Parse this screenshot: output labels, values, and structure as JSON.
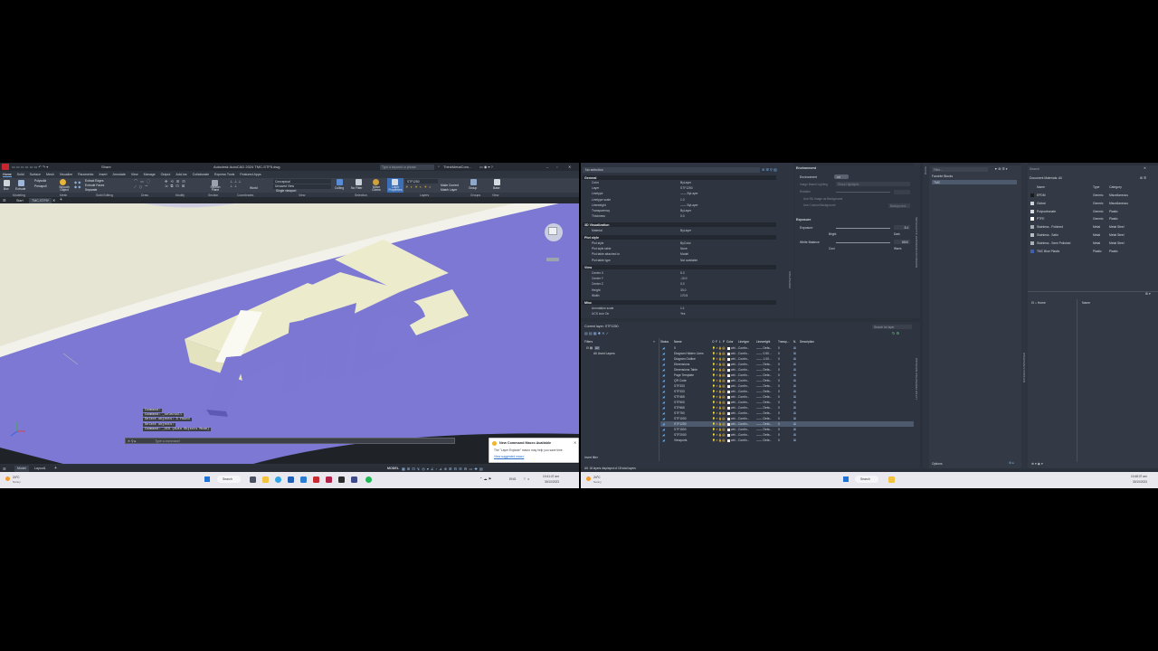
{
  "left": {
    "title": "Autodesk AutoCAD 2024    TMC-STF5.dwg",
    "share": "Share",
    "search_placeholder": "Type a keyword or phrase",
    "user": "ThinkMetalCom...",
    "tabs": [
      "Home",
      "Solid",
      "Surface",
      "Mesh",
      "Visualize",
      "Parametric",
      "Insert",
      "Annotate",
      "View",
      "Manage",
      "Output",
      "Add-ins",
      "Collaborate",
      "Express Tools",
      "Featured Apps"
    ],
    "ribbon": {
      "box": "Box",
      "extrude": "Extrude",
      "polysolid": "Polysolid",
      "presspull": "Presspull",
      "smooth_object": "Smooth Object",
      "extract_edges": "Extract Edges",
      "extrude_faces": "Extrude Faces",
      "separate": "Separate",
      "section_plane": "Section Plane",
      "visual_style": "Conceptual",
      "view": "Unsaved View",
      "world": "World",
      "single_viewport": "Single viewport",
      "culling": "Culling",
      "no_filter": "No Filter",
      "move_gizmo": "Move Gizmo",
      "layer_properties": "Layer Properties",
      "layer_current": "STF1250",
      "make_current": "Make Current",
      "match_layer": "Match Layer",
      "group": "Group",
      "base": "Base"
    },
    "ribbon_panels": [
      "Modeling",
      "Mesh",
      "Solid Editing",
      "Draw",
      "Modify",
      "Section",
      "Coordinates",
      "View",
      "Selection",
      "Layers",
      "Groups",
      "View"
    ],
    "doc_tabs": [
      "Start",
      "TMC-STF5*"
    ],
    "model_text": "TMC",
    "command_lines": [
      "Command:",
      "Command: _selectall",
      "Select objects: 3 found",
      "Select objects:",
      "Command: _UCS (Auto Objects Mode)"
    ],
    "command_placeholder": "Type a command",
    "layout_tabs": [
      "Model",
      "Layout1"
    ],
    "model_label": "MODEL",
    "notification": {
      "title": "New Command Macro Available",
      "body": "The \"Layer Explode\" macro may help you save time.",
      "link": "View suggested macro"
    },
    "taskbar": {
      "weather_temp": "24°C",
      "weather_desc": "Sunny",
      "search": "Search",
      "lang": "ENG",
      "time": "10:41:47 am",
      "date": "30/10/2023"
    }
  },
  "right": {
    "properties": {
      "selection": "No selection",
      "sections": {
        "general": "General",
        "visualization": "3D Visualization",
        "plot_style": "Plot style",
        "view": "View",
        "misc": "Misc"
      },
      "general_rows": [
        [
          "Color",
          "ByLayer"
        ],
        [
          "Layer",
          "STF1250"
        ],
        [
          "Linetype",
          "—— ByLayer"
        ],
        [
          "Linetype scale",
          "1.0"
        ],
        [
          "Lineweight",
          "—— ByLayer"
        ],
        [
          "Transparency",
          "ByLayer"
        ],
        [
          "Thickness",
          "0.0"
        ]
      ],
      "viz_rows": [
        [
          "Material",
          "ByLayer"
        ]
      ],
      "plot_rows": [
        [
          "Plot style",
          "ByColor"
        ],
        [
          "Plot style table",
          "None"
        ],
        [
          "Plot table attached to",
          "Model"
        ],
        [
          "Plot table type",
          "Not available"
        ]
      ],
      "view_rows": [
        [
          "Center X",
          "5.3"
        ],
        [
          "Center Y",
          "-10.0"
        ],
        [
          "Center Z",
          "0.0"
        ],
        [
          "Height",
          "33.0"
        ],
        [
          "Width",
          "170.5"
        ]
      ],
      "misc_rows": [
        [
          "Annotation scale",
          "1:1"
        ],
        [
          "UCS icon On",
          "Yes"
        ]
      ]
    },
    "render": {
      "environment_title": "Environment",
      "environment_label": "Environment",
      "environment_value": "Off",
      "image_lighting": "Image Based Lighting",
      "image_lighting_value": "Sharp Highlights",
      "rotation": "Rotation",
      "use_ibl": "Use IBL Image as Background",
      "use_custom": "Use Custom Background",
      "background_btn": "Background...",
      "exposure_title": "Exposure",
      "exposure_label": "Exposure",
      "exposure_value": "8.4",
      "bright": "Bright",
      "dark": "Dark",
      "white_balance": "White Balance",
      "white_balance_value": "6500",
      "cool": "Cool",
      "warm": "Warm"
    },
    "layers": {
      "current_layer": "Current layer: STF1250",
      "search": "Search for layer",
      "filters_label": "Filters",
      "filter_all": "All",
      "filter_used": "All Used Layers",
      "invert_filter": "Invert filter",
      "columns": [
        "Status",
        "Name",
        "O",
        "F",
        "L",
        "P",
        "Color",
        "Linetype",
        "Lineweight",
        "Transp...",
        "N.",
        "Description"
      ],
      "rows": [
        [
          "0",
          "whi...",
          "Contin...",
          "—— Defa...",
          "0"
        ],
        [
          "Diagram Hidden Lines",
          "whi...",
          "Contin...",
          "—— 0.50...",
          "0"
        ],
        [
          "Diagram Outline",
          "whi...",
          "Contin...",
          "—— 1.00...",
          "0"
        ],
        [
          "Dimensions",
          "whi...",
          "Contin...",
          "—— Defa...",
          "0"
        ],
        [
          "Dimensions Table",
          "whi...",
          "Contin...",
          "—— Defa...",
          "0"
        ],
        [
          "Page Template",
          "whi...",
          "Contin...",
          "—— Defa...",
          "0"
        ],
        [
          "QR Code",
          "whi...",
          "Contin...",
          "—— Defa...",
          "0"
        ],
        [
          "STF333",
          "whi...",
          "Contin...",
          "—— Defa...",
          "0"
        ],
        [
          "STF333",
          "whi...",
          "Contin...",
          "—— Defa...",
          "0"
        ],
        [
          "STF465",
          "whi...",
          "Contin...",
          "—— Defa...",
          "0"
        ],
        [
          "STF500",
          "whi...",
          "Contin...",
          "—— Defa...",
          "0"
        ],
        [
          "STF665",
          "whi...",
          "Contin...",
          "—— Defa...",
          "0"
        ],
        [
          "STF750",
          "whi...",
          "Contin...",
          "—— Defa...",
          "0"
        ],
        [
          "STF1000",
          "whi...",
          "Contin...",
          "—— Defa...",
          "0"
        ],
        [
          "STF1250",
          "whi...",
          "Contin...",
          "—— Defa...",
          "0"
        ],
        [
          "STF1500",
          "whi...",
          "Contin...",
          "—— Defa...",
          "0"
        ],
        [
          "STF2000",
          "whi...",
          "Contin...",
          "—— Defa...",
          "0"
        ],
        [
          "Viewports",
          "whi...",
          "Contin...",
          "—— Defa...",
          "0"
        ]
      ],
      "selected_row": 14,
      "footer": "All: 18 layers displayed of 18 total layers"
    },
    "blocks": {
      "filter_placeholder": "Filter...",
      "favorite_blocks": "Favorite Blocks",
      "tmc": "TMC",
      "options": "Options"
    },
    "materials": {
      "search": "Search",
      "document_materials": "Document Materials: All",
      "columns": [
        "Name",
        "Type",
        "Category"
      ],
      "rows": [
        [
          "EPDM",
          "Generic",
          "Miscellaneous"
        ],
        [
          "Global",
          "Generic",
          "Miscellaneous"
        ],
        [
          "Polycarbonate",
          "Generic",
          "Plastic"
        ],
        [
          "PTFE",
          "Generic",
          "Plastic"
        ],
        [
          "Stainless - Polished",
          "Metal",
          "Metal Steel"
        ],
        [
          "Stainless - Satin",
          "Metal",
          "Metal Steel"
        ],
        [
          "Stainless - Semi Polished",
          "Metal",
          "Metal Steel"
        ],
        [
          "TMC Blue Plastic",
          "Plastic",
          "Plastic"
        ]
      ],
      "swatches": [
        "#1c1c1c",
        "#cfd2d6",
        "#d9dadb",
        "#ffffff",
        "#a8adb3",
        "#b9bdc2",
        "#aeb2b7",
        "#3f5fb0"
      ],
      "library_home": "Home",
      "library_name_col": "Name"
    },
    "vertical_tabs": [
      "PROPERTIES",
      "LAYER PROPERTIES MANAGER",
      "BLOCKS",
      "MATERIALS BROWSER",
      "RENDER ENVIRONMENT & EXPOSURE"
    ],
    "taskbar": {
      "weather_temp": "24°C",
      "weather_desc": "Sunny",
      "search": "Search",
      "time": "10:48:37 am",
      "date": "30/10/2023"
    }
  },
  "colors": {
    "model_face": "#e8e6cc",
    "model_side": "#7b77d2",
    "background_panel": "#2b313b",
    "accent": "#3a7bd5"
  }
}
